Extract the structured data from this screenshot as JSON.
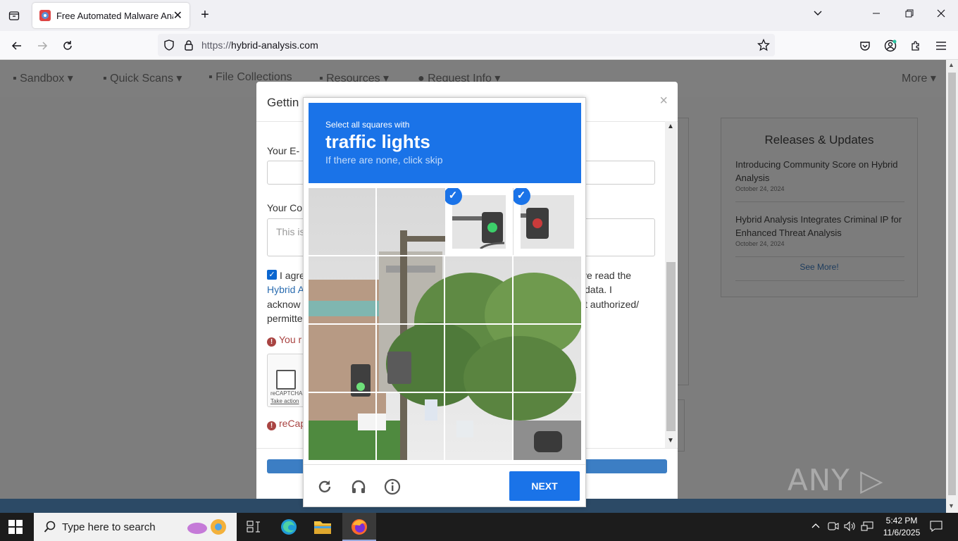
{
  "browser": {
    "tab_title": "Free Automated Malware Analy",
    "url_proto": "https://",
    "url_host": "hybrid-analysis.com"
  },
  "site_nav": {
    "items": [
      "Sandbox ▾",
      "Quick Scans ▾",
      "File Collections",
      "Resources ▾",
      "Request Info ▾"
    ],
    "more": "More ▾"
  },
  "releases": {
    "title": "Releases & Updates",
    "items": [
      {
        "title": "Introducing Community Score on Hybrid Analysis",
        "date": "October 24, 2024"
      },
      {
        "title": "Hybrid Analysis Integrates Criminal IP for Enhanced Threat Analysis",
        "date": "October 24, 2024"
      }
    ],
    "see_more": "See More!"
  },
  "modal": {
    "title": "Gettin",
    "close": "×",
    "email_label": "Your E-",
    "comment_label": "Your Co",
    "comment_placeholder": "This is",
    "agree_line1_left": "I agre",
    "agree_line1_right": "ve read the",
    "agree_line2_left": "Hybrid A",
    "agree_line2_right": "data. I",
    "agree_line3_left": "acknow",
    "agree_line3_right": "t authorized/",
    "agree_line4_left": "permitte",
    "error1": "You r",
    "error2": "reCap",
    "recaptcha_label": "reCAPTCHA",
    "recaptcha_action": "Take action"
  },
  "captcha": {
    "instruction": "Select all squares with",
    "target": "traffic lights",
    "hint": "If there are none, click skip",
    "next": "NEXT",
    "selected_tiles": [
      2,
      3
    ]
  },
  "taskbar": {
    "search_placeholder": "Type here to search",
    "time": "5:42 PM",
    "date": "11/6/2025"
  },
  "watermark": "ANY ▷ RUN"
}
